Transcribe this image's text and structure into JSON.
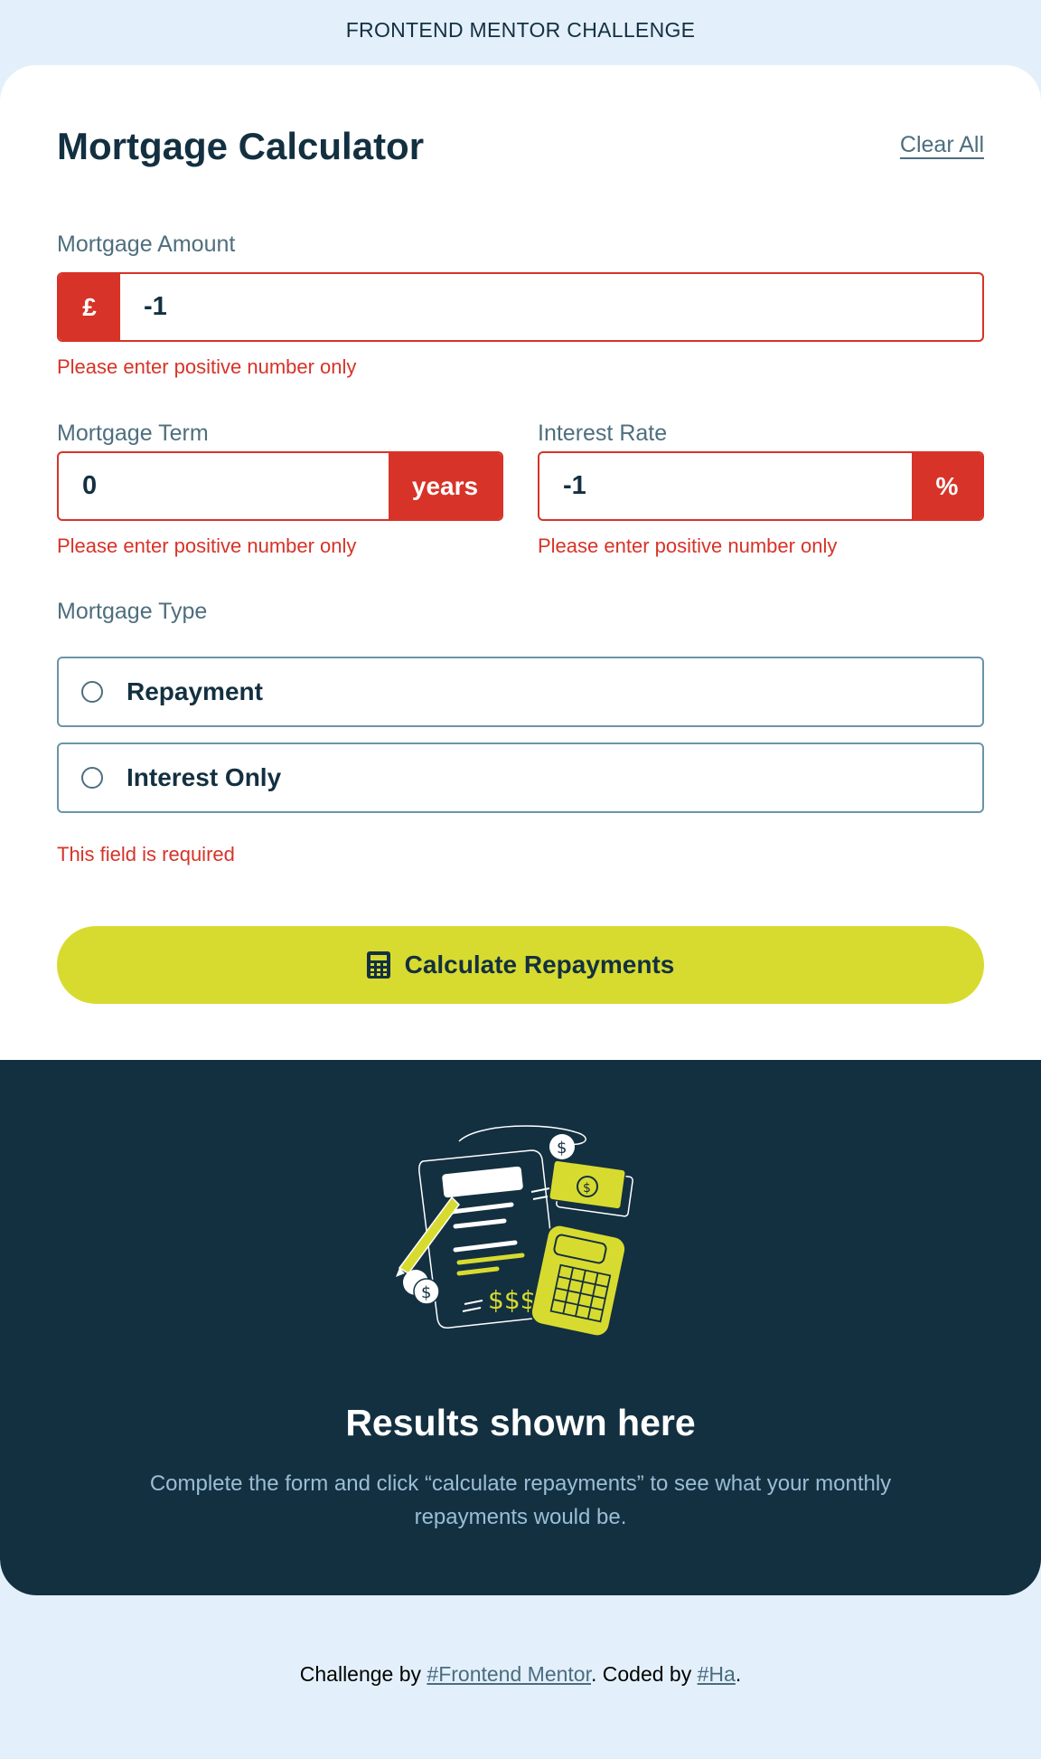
{
  "header": {
    "challenge_title": "FRONTEND MENTOR CHALLENGE"
  },
  "calculator": {
    "title": "Mortgage Calculator",
    "clear_all": "Clear All",
    "amount": {
      "label": "Mortgage Amount",
      "prefix": "£",
      "value": "-1",
      "error": "Please enter positive number only"
    },
    "term": {
      "label": "Mortgage Term",
      "suffix": "years",
      "value": "0",
      "error": "Please enter positive number only"
    },
    "rate": {
      "label": "Interest Rate",
      "suffix": "%",
      "value": "-1",
      "error": "Please enter positive number only"
    },
    "type": {
      "label": "Mortgage Type",
      "options": [
        "Repayment",
        "Interest Only"
      ],
      "error": "This field is required"
    },
    "submit_label": "Calculate Repayments"
  },
  "results": {
    "title": "Results shown here",
    "description": "Complete the form and click “calculate repayments” to see what your monthly repayments would be."
  },
  "footer": {
    "prefix": "Challenge by ",
    "mentor_link": "#Frontend Mentor",
    "middle": ". Coded by ",
    "author_link": "#Ha",
    "suffix": "."
  },
  "colors": {
    "error": "#d73328",
    "lime": "#d8db2f",
    "slate_900": "#133041",
    "page_bg": "#e3f0fb"
  },
  "icons": [
    "calculator-icon",
    "empty-results-illustration"
  ]
}
